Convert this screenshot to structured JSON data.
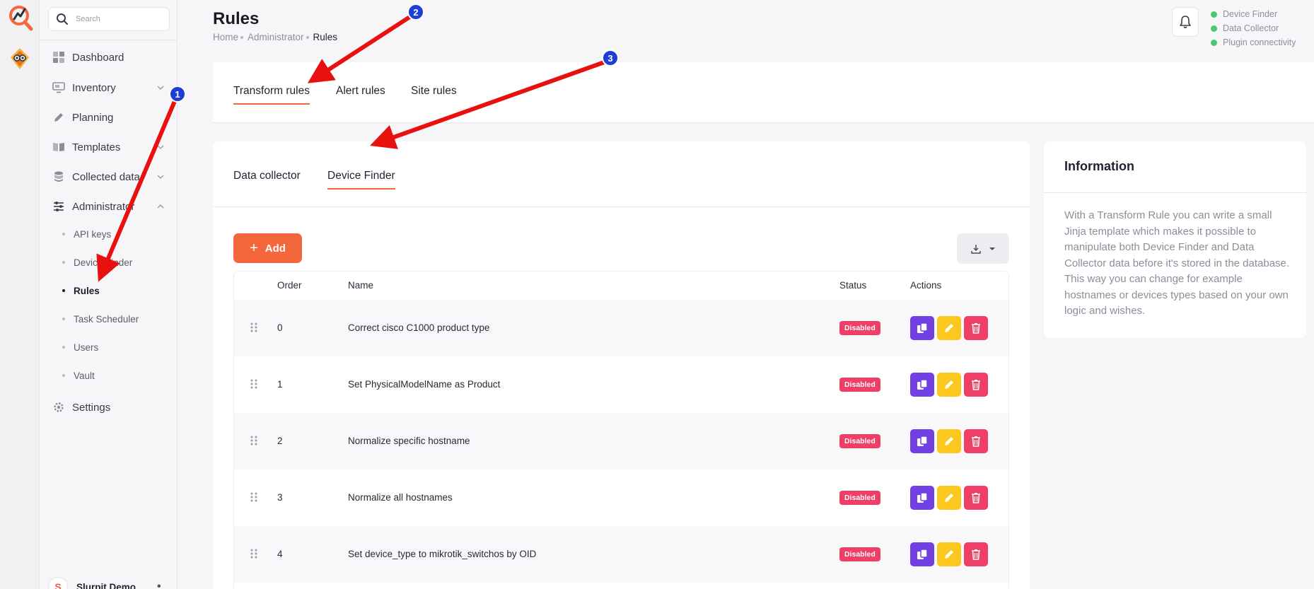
{
  "search": {
    "placeholder": "Search"
  },
  "sidebar": {
    "items": [
      {
        "label": "Dashboard",
        "icon": "dashboard-icon"
      },
      {
        "label": "Inventory",
        "icon": "monitor-icon"
      },
      {
        "label": "Planning",
        "icon": "pencil-icon"
      },
      {
        "label": "Templates",
        "icon": "book-icon"
      },
      {
        "label": "Collected data",
        "icon": "database-icon"
      },
      {
        "label": "Administrator",
        "icon": "sliders-icon"
      },
      {
        "label": "Settings",
        "icon": "gear-icon"
      }
    ],
    "admin_sub": [
      {
        "label": "API keys"
      },
      {
        "label": "Device Finder"
      },
      {
        "label": "Rules"
      },
      {
        "label": "Task Scheduler"
      },
      {
        "label": "Users"
      },
      {
        "label": "Vault"
      }
    ],
    "user": {
      "initial": "S",
      "name": "Slurpit Demo"
    }
  },
  "header": {
    "title": "Rules",
    "breadcrumb": [
      "Home",
      "Administrator",
      "Rules"
    ]
  },
  "status": [
    {
      "label": "Device Finder",
      "color": "#4cc773"
    },
    {
      "label": "Data Collector",
      "color": "#4cc773"
    },
    {
      "label": "Plugin connectivity",
      "color": "#4cc773"
    }
  ],
  "tabs": [
    "Transform rules",
    "Alert rules",
    "Site rules"
  ],
  "subtabs": [
    "Data collector",
    "Device Finder"
  ],
  "toolbar": {
    "add_label": "Add"
  },
  "table": {
    "headers": {
      "order": "Order",
      "name": "Name",
      "status": "Status",
      "actions": "Actions"
    },
    "rows": [
      {
        "order": "0",
        "name": "Correct cisco C1000 product type",
        "status": "Disabled"
      },
      {
        "order": "1",
        "name": "Set PhysicalModelName as Product",
        "status": "Disabled"
      },
      {
        "order": "2",
        "name": "Normalize specific hostname",
        "status": "Disabled"
      },
      {
        "order": "3",
        "name": "Normalize all hostnames",
        "status": "Disabled"
      },
      {
        "order": "4",
        "name": "Set device_type to mikrotik_switchos by OID",
        "status": "Disabled"
      }
    ]
  },
  "info": {
    "title": "Information",
    "body": "With a Transform Rule you can write a small Jinja template which makes it possible to manipulate both Device Finder and Data Collector data before it's stored in the database. This way you can change for example hostnames or devices types based on your own logic and wishes."
  },
  "annotations": [
    "1",
    "2",
    "3"
  ],
  "colors": {
    "accent": "#f4663c",
    "copy": "#7240e2",
    "edit": "#fcc81f",
    "delete": "#ee3f66",
    "status_ok": "#4cc773",
    "marker": "#1d3fd6",
    "arrow": "#e8110f"
  }
}
